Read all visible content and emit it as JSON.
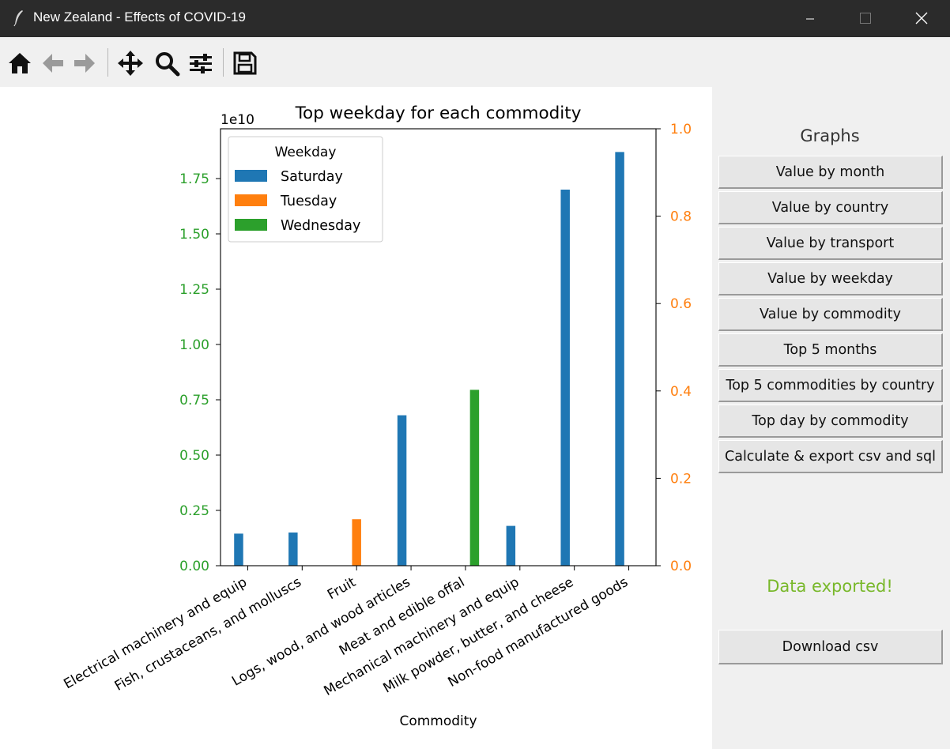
{
  "window": {
    "title": "New Zealand - Effects of COVID-19"
  },
  "toolbar": {
    "buttons": [
      "home-icon",
      "back-arrow-icon",
      "forward-arrow-icon",
      "pan-icon",
      "zoom-icon",
      "configure-subplots-icon",
      "save-icon"
    ]
  },
  "chart_data": {
    "type": "bar",
    "title": "Top weekday for each commodity",
    "xlabel": "Commodity",
    "ylabel": "",
    "y_offset_label": "1e10",
    "ylim": [
      0,
      1.975
    ],
    "y_ticks": [
      "0.00",
      "0.25",
      "0.50",
      "0.75",
      "1.00",
      "1.25",
      "1.50",
      "1.75"
    ],
    "y2lim": [
      0,
      1
    ],
    "y2_ticks": [
      "0.0",
      "0.2",
      "0.4",
      "0.6",
      "0.8",
      "1.0"
    ],
    "categories": [
      "Electrical machinery and equip",
      "Fish, crustaceans, and molluscs",
      "Fruit",
      "Logs, wood, and wood articles",
      "Meat and edible offal",
      "Mechanical machinery and equip",
      "Milk powder, butter, and cheese",
      "Non-food manufactured goods"
    ],
    "legend_title": "Weekday",
    "legend_position": "top-left",
    "grid": false,
    "series": [
      {
        "name": "Saturday",
        "color": "#1f77b4",
        "values": [
          0.145,
          0.15,
          null,
          0.68,
          null,
          0.18,
          1.7,
          1.87
        ]
      },
      {
        "name": "Tuesday",
        "color": "#ff7f0e",
        "values": [
          null,
          null,
          0.21,
          null,
          null,
          null,
          null,
          null
        ]
      },
      {
        "name": "Wednesday",
        "color": "#2ca02c",
        "values": [
          null,
          null,
          null,
          null,
          0.795,
          null,
          null,
          null
        ]
      }
    ],
    "left_axis_color": "#2ca02c",
    "right_axis_color": "#ff7f0e"
  },
  "sidebar": {
    "heading": "Graphs",
    "buttons": [
      "Value by month",
      "Value by country",
      "Value by transport",
      "Value by weekday",
      "Value by commodity",
      "Top 5 months",
      "Top 5 commodities by country",
      "Top day by commodity",
      "Calculate & export csv and sql"
    ],
    "status": "Data exported!",
    "status_color": "#78b82a",
    "download_button": "Download csv"
  }
}
